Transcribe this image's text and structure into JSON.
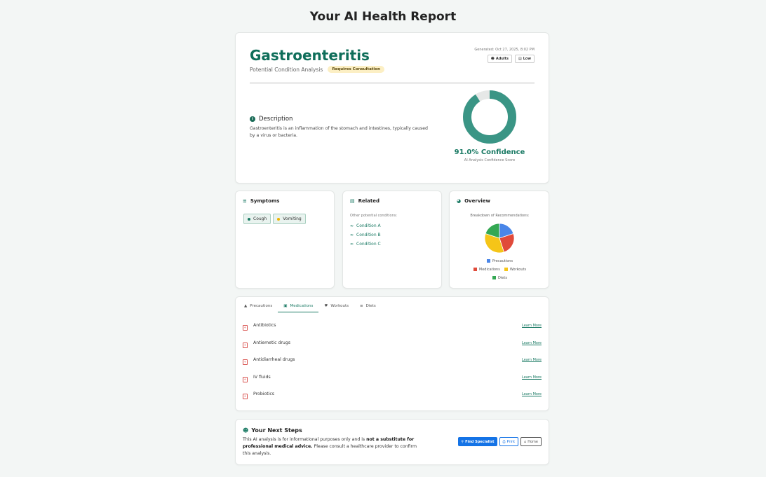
{
  "page": {
    "title": "Your AI Health Report"
  },
  "condition": {
    "name": "Gastroenteritis",
    "subtitle": "Potential Condition Analysis",
    "badge": "Requires Consultation",
    "generated": "Generated: Oct 27, 2025, 8:02 PM",
    "tags": [
      {
        "icon": "person-icon",
        "label": "Adults"
      },
      {
        "icon": "chart-icon",
        "label": "Low"
      }
    ],
    "description_heading": "Description",
    "description": "Gastroenteritis is an inflammation of the stomach and intestines, typically caused by a virus or bacteria.",
    "confidence_value": 0.91,
    "confidence_text": "91.0% Confidence",
    "confidence_label": "AI Analysis Confidence Score",
    "accent_color": "#3a9585"
  },
  "symptoms": {
    "heading": "Symptoms",
    "items": [
      {
        "label": "Cough",
        "color": "#1a7a64"
      },
      {
        "label": "Vomiting",
        "color": "#f0b400"
      }
    ]
  },
  "related": {
    "heading": "Related",
    "label": "Other potential conditions:",
    "items": [
      "Condition A",
      "Condition B",
      "Condition C"
    ]
  },
  "overview": {
    "heading": "Overview",
    "label": "Breakdown of Recommendations:",
    "legend": [
      {
        "label": "Precautions",
        "color": "#4a86e8"
      },
      {
        "label": "Medications",
        "color": "#e04a3a"
      },
      {
        "label": "Workouts",
        "color": "#f5c518"
      },
      {
        "label": "Diets",
        "color": "#34a853"
      }
    ]
  },
  "chart_data": {
    "type": "pie",
    "categories": [
      "Precautions",
      "Medications",
      "Workouts",
      "Diets"
    ],
    "values": [
      4,
      5,
      7,
      4
    ],
    "colors": [
      "#4a86e8",
      "#e04a3a",
      "#f5c518",
      "#34a853"
    ],
    "title": "Breakdown of Recommendations:"
  },
  "tabs": [
    {
      "icon": "warning-icon",
      "label": "Precautions"
    },
    {
      "icon": "pill-icon",
      "label": "Medications"
    },
    {
      "icon": "heart-icon",
      "label": "Workouts"
    },
    {
      "icon": "list-icon",
      "label": "Diets"
    }
  ],
  "active_tab": "Medications",
  "medications": {
    "learn_more": "Learn More",
    "items": [
      "Antibiotics",
      "Antiemetic drugs",
      "Antidiarrheal drugs",
      "IV fluids",
      "Probiotics"
    ]
  },
  "next_steps": {
    "heading": "Your Next Steps",
    "text_before": "This AI analysis is for informational purposes only and is ",
    "text_bold": "not a substitute for professional medical advice.",
    "text_after": " Please consult a healthcare provider to confirm this analysis.",
    "find_specialist": "Find Specialist",
    "print": "Print",
    "home": "Home"
  }
}
